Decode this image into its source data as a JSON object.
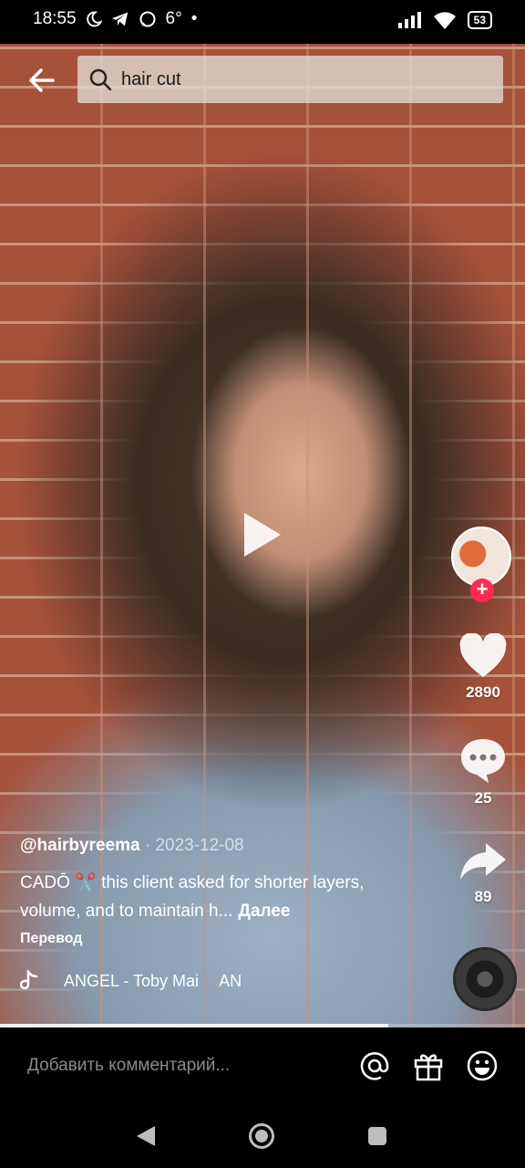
{
  "status_bar": {
    "time": "18:55",
    "temperature": "6°",
    "dot": "•",
    "battery": "53"
  },
  "search": {
    "query": "hair cut"
  },
  "video": {
    "author": "@hairbyreema",
    "date": "· 2023-12-08",
    "caption": "CADŌ ✂️ this client asked for shorter layers, volume, and to maintain h...",
    "more_label": "Далее",
    "translate_label": "Перевод",
    "music_title": "ANGEL - Toby Mai",
    "music_title_repeat": "AN",
    "progress": 0.74
  },
  "actions": {
    "likes": "2890",
    "comments": "25",
    "shares": "89",
    "follow_symbol": "+"
  },
  "comment_bar": {
    "placeholder": "Добавить комментарий..."
  },
  "colors": {
    "follow": "#fe2c55",
    "background": "#000000"
  }
}
